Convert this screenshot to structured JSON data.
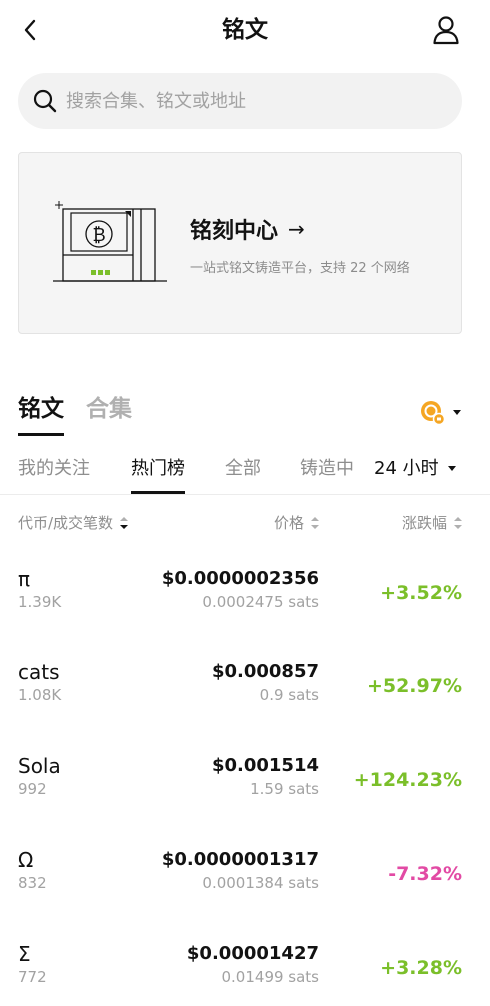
{
  "header": {
    "title": "铭文"
  },
  "search": {
    "placeholder": "搜索合集、铭文或地址"
  },
  "banner": {
    "title": "铭刻中心",
    "arrow": "→",
    "subtitle": "一站式铭文铸造平台，支持 22 个网络"
  },
  "tabs": [
    "铭文",
    "合集"
  ],
  "subtabs": [
    "我的关注",
    "热门榜",
    "全部",
    "铸造中"
  ],
  "time_filter": "24 小时",
  "columns": {
    "token": "代币/成交笔数",
    "price": "价格",
    "change": "涨跌幅"
  },
  "rows": [
    {
      "name": "π",
      "count": "1.39K",
      "price": "$0.0000002356",
      "sats": "0.0002475 sats",
      "change": "+3.52%",
      "direction": "up"
    },
    {
      "name": "cats",
      "count": "1.08K",
      "price": "$0.000857",
      "sats": "0.9 sats",
      "change": "+52.97%",
      "direction": "up"
    },
    {
      "name": "Sola",
      "count": "992",
      "price": "$0.001514",
      "sats": "1.59 sats",
      "change": "+124.23%",
      "direction": "up"
    },
    {
      "name": "Ω",
      "count": "832",
      "price": "$0.0000001317",
      "sats": "0.0001384 sats",
      "change": "-7.32%",
      "direction": "down"
    },
    {
      "name": "Σ",
      "count": "772",
      "price": "$0.00001427",
      "sats": "0.01499 sats",
      "change": "+3.28%",
      "direction": "up"
    }
  ],
  "colors": {
    "up": "#7bbf2a",
    "down": "#e24aa4",
    "accent_orange": "#f5a623"
  },
  "icons": {
    "back": "chevron-left-icon",
    "profile": "user-icon",
    "search": "search-icon",
    "network": "btc-network-icon"
  }
}
